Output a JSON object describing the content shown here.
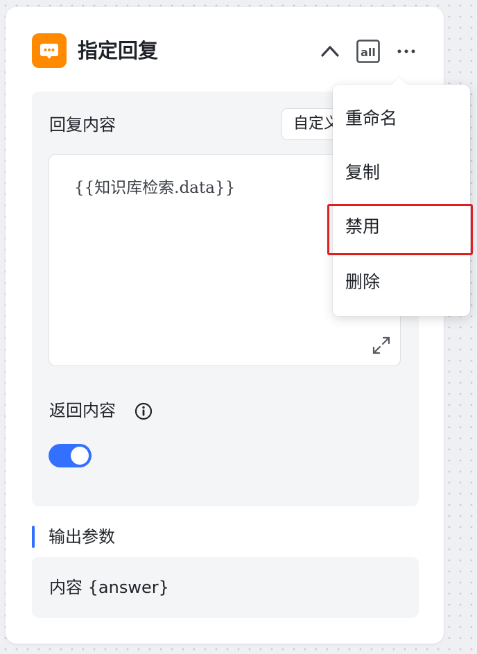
{
  "node": {
    "title": "指定回复",
    "icon": "chat-bubble-icon",
    "accent_color": "#ff8a00"
  },
  "header_actions": {
    "collapse_icon": "chevron-up-icon",
    "batch_icon": "batch-all-icon",
    "batch_label": "all",
    "more_icon": "more-dots-icon"
  },
  "reply": {
    "label": "回复内容",
    "mode": "自定义",
    "content": "{{知识库检索.data}}",
    "expand_icon": "expand-icon"
  },
  "return_content": {
    "label": "返回内容",
    "info_icon": "info-icon",
    "enabled": true,
    "toggle_color": "#3370ff"
  },
  "output": {
    "title": "输出参数",
    "items": [
      {
        "label": "内容 {answer}"
      }
    ]
  },
  "menu": {
    "items": [
      {
        "label": "重命名"
      },
      {
        "label": "复制"
      },
      {
        "label": "禁用"
      },
      {
        "label": "删除"
      }
    ],
    "highlighted_item": "禁用",
    "highlight_color": "#e02020"
  }
}
